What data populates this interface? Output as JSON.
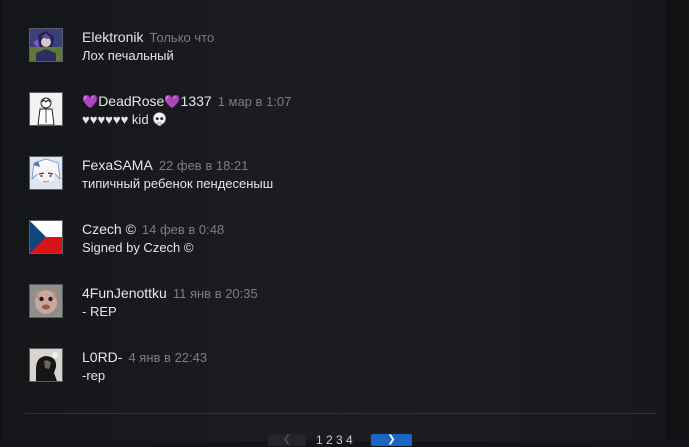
{
  "comments": [
    {
      "author": "Elektronik",
      "timestamp": "Только что",
      "text": "Лох печальный",
      "avatar_icon": "anime-character-avatar"
    },
    {
      "author_prefix_icon": "purple-heart",
      "author": "DeadRose",
      "author_suffix": "1337",
      "timestamp": "1 мар в 1:07",
      "text": "♥♥♥♥♥♥ kid",
      "avatar_icon": "white-figure-avatar"
    },
    {
      "author": "FexaSAMA",
      "timestamp": "22 фев в 18:21",
      "text": "типичный ребенок пендесеныш",
      "avatar_icon": "anime-girl-avatar"
    },
    {
      "author": "Czech ©",
      "timestamp": "14 фев в 0:48",
      "text": "Signed by Czech ©",
      "avatar_icon": "czech-flag-avatar"
    },
    {
      "author": "4FunJenottku",
      "timestamp": "11 янв в 20:35",
      "text": "- REP",
      "avatar_icon": "creature-avatar"
    },
    {
      "author": "L0RD-",
      "timestamp": "4 янв в 22:43",
      "text": "-rep",
      "avatar_icon": "silhouette-avatar"
    }
  ],
  "pagination": {
    "pages": "1 2 3 4",
    "prev_icon": "chevron-left-icon",
    "next_icon": "chevron-right-icon"
  },
  "colors": {
    "background": "#1b1d21",
    "author": "#e6e7e8",
    "timestamp": "#7a7d82",
    "heart": "#9b59ff",
    "next_button": "#1a66c2"
  }
}
